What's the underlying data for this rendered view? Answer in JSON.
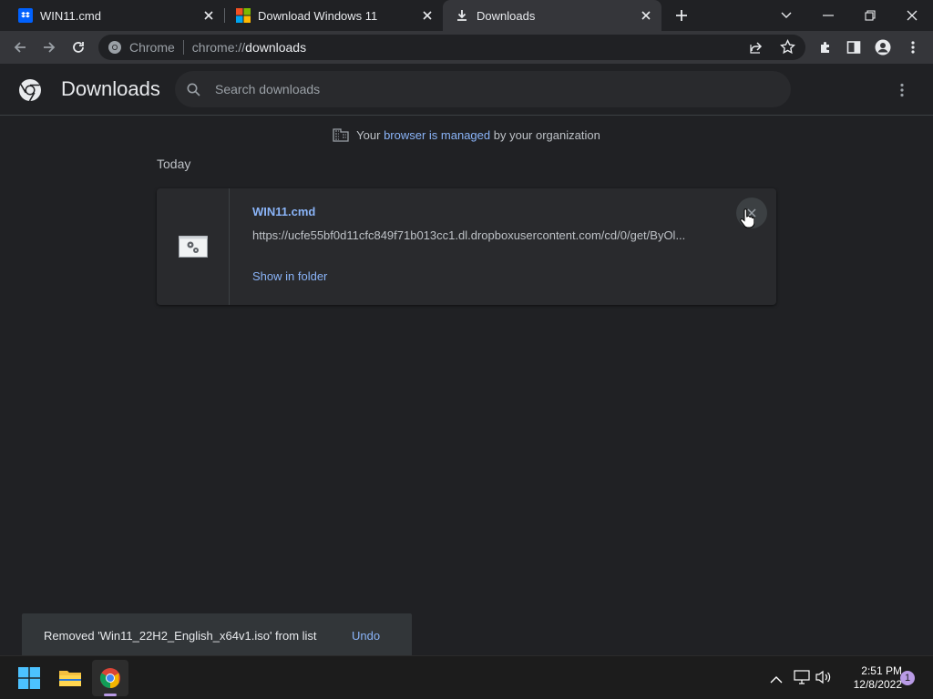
{
  "tabs": [
    {
      "title": "WIN11.cmd",
      "favicon": "dropbox-icon"
    },
    {
      "title": "Download Windows 11",
      "favicon": "microsoft-icon"
    },
    {
      "title": "Downloads",
      "favicon": "download-icon",
      "active": true
    }
  ],
  "omnibox": {
    "chip_label": "Chrome",
    "url_scheme": "chrome://",
    "url_host": "downloads"
  },
  "downloads_page": {
    "title": "Downloads",
    "search_placeholder": "Search downloads",
    "managed_prefix": "Your",
    "managed_link": "browser is managed",
    "managed_suffix": "by your organization",
    "section_label": "Today",
    "items": [
      {
        "file_name": "WIN11.cmd",
        "url": "https://ucfe55bf0d11cfc849f71b013cc1.dl.dropboxusercontent.com/cd/0/get/ByOl...",
        "action_label": "Show in folder"
      }
    ]
  },
  "toast": {
    "message": "Removed 'Win11_22H2_English_x64v1.iso' from list",
    "action_label": "Undo"
  },
  "taskbar": {
    "time": "2:51 PM",
    "date": "12/8/2022",
    "notification_count": "1"
  },
  "colors": {
    "accent_link": "#8ab4f8",
    "background": "#202124",
    "toolbar": "#35363a",
    "card": "#292a2d"
  }
}
